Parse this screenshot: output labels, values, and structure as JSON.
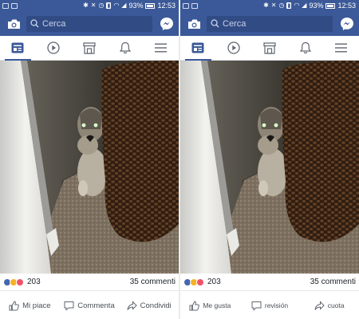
{
  "status": {
    "battery": "93%",
    "time": "12:53"
  },
  "search": {
    "placeholder": "Cerca"
  },
  "post": {
    "reaction_count": "203",
    "comments": "35 commenti"
  },
  "left_actions": {
    "like": "Mi piace",
    "comment": "Commenta",
    "share": "Condividi"
  },
  "right_actions": {
    "like": "Me gusta",
    "comment": "revisión",
    "share": "cuota"
  },
  "colors": {
    "brand": "#3b5998",
    "like_blue": "#4267b2",
    "love_red": "#f25268",
    "haha_yellow": "#f7b125"
  },
  "icons": [
    "camera-icon",
    "search-icon",
    "messenger-icon",
    "news-feed-icon",
    "video-icon",
    "marketplace-icon",
    "notifications-icon",
    "menu-icon",
    "like-icon",
    "comment-icon",
    "share-icon"
  ]
}
